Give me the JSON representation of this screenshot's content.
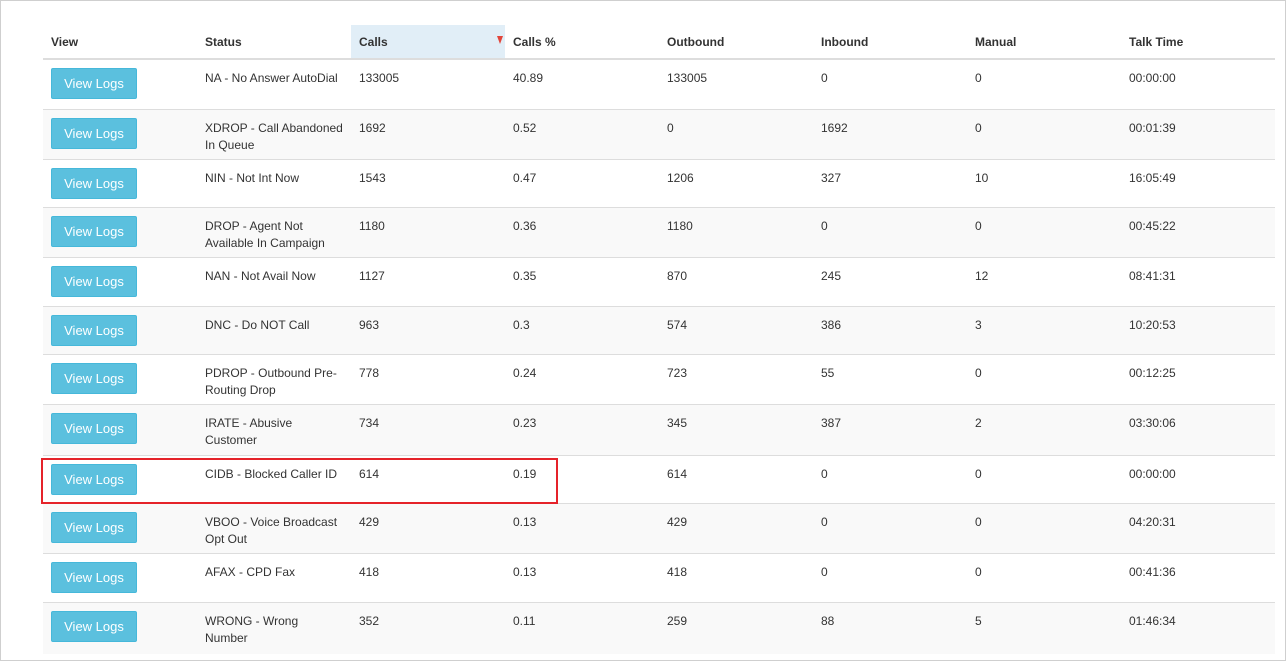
{
  "table": {
    "headers": {
      "view": "View",
      "status": "Status",
      "calls": "Calls",
      "calls_pct": "Calls %",
      "outbound": "Outbound",
      "inbound": "Inbound",
      "manual": "Manual",
      "talk_time": "Talk Time"
    },
    "sorted_column": "calls",
    "sort_direction": "descending",
    "button_label": "View Logs",
    "highlighted_row_index": 8,
    "rows": [
      {
        "status": "NA - No Answer AutoDial",
        "calls": "133005",
        "calls_pct": "40.89",
        "outbound": "133005",
        "inbound": "0",
        "manual": "0",
        "talk_time": "00:00:00"
      },
      {
        "status": "XDROP - Call Abandoned In Queue",
        "calls": "1692",
        "calls_pct": "0.52",
        "outbound": "0",
        "inbound": "1692",
        "manual": "0",
        "talk_time": "00:01:39"
      },
      {
        "status": "NIN - Not Int Now",
        "calls": "1543",
        "calls_pct": "0.47",
        "outbound": "1206",
        "inbound": "327",
        "manual": "10",
        "talk_time": "16:05:49"
      },
      {
        "status": "DROP - Agent Not Available In Campaign",
        "calls": "1180",
        "calls_pct": "0.36",
        "outbound": "1180",
        "inbound": "0",
        "manual": "0",
        "talk_time": "00:45:22"
      },
      {
        "status": "NAN - Not Avail Now",
        "calls": "1127",
        "calls_pct": "0.35",
        "outbound": "870",
        "inbound": "245",
        "manual": "12",
        "talk_time": "08:41:31"
      },
      {
        "status": "DNC - Do NOT Call",
        "calls": "963",
        "calls_pct": "0.3",
        "outbound": "574",
        "inbound": "386",
        "manual": "3",
        "talk_time": "10:20:53"
      },
      {
        "status": "PDROP - Outbound Pre-Routing Drop",
        "calls": "778",
        "calls_pct": "0.24",
        "outbound": "723",
        "inbound": "55",
        "manual": "0",
        "talk_time": "00:12:25"
      },
      {
        "status": "IRATE - Abusive Customer",
        "calls": "734",
        "calls_pct": "0.23",
        "outbound": "345",
        "inbound": "387",
        "manual": "2",
        "talk_time": "03:30:06"
      },
      {
        "status": "CIDB - Blocked Caller ID",
        "calls": "614",
        "calls_pct": "0.19",
        "outbound": "614",
        "inbound": "0",
        "manual": "0",
        "talk_time": "00:00:00"
      },
      {
        "status": "VBOO - Voice Broadcast Opt Out",
        "calls": "429",
        "calls_pct": "0.13",
        "outbound": "429",
        "inbound": "0",
        "manual": "0",
        "talk_time": "04:20:31"
      },
      {
        "status": "AFAX - CPD Fax",
        "calls": "418",
        "calls_pct": "0.13",
        "outbound": "418",
        "inbound": "0",
        "manual": "0",
        "talk_time": "00:41:36"
      },
      {
        "status": "WRONG - Wrong Number",
        "calls": "352",
        "calls_pct": "0.11",
        "outbound": "259",
        "inbound": "88",
        "manual": "5",
        "talk_time": "01:46:34"
      }
    ]
  },
  "colors": {
    "button": "#5bc0de",
    "sorted_header": "#e1eef7",
    "sort_arrow": "#e2453a",
    "highlight_box": "#e5232a"
  }
}
